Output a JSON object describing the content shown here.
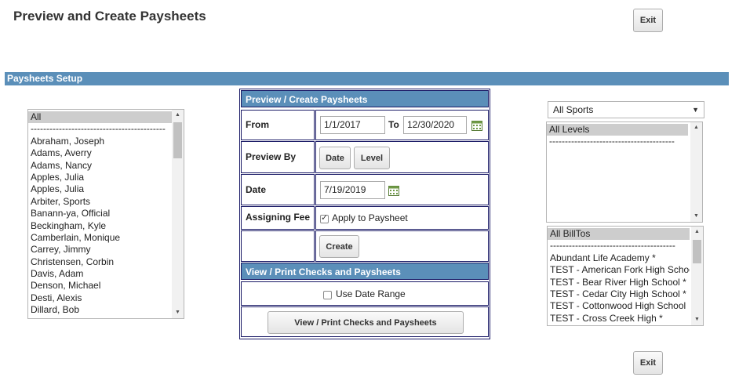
{
  "header": {
    "title": "Preview and Create Paysheets",
    "exit_label": "Exit"
  },
  "setup_bar": {
    "label": "Paysheets Setup"
  },
  "officials_list": {
    "items": [
      "All",
      "-------------------------------------------",
      "Abraham, Joseph",
      "Adams, Averry",
      "Adams, Nancy",
      "Apples, Julia",
      "Apples, Julia",
      "Arbiter, Sports",
      "Banann-ya, Official",
      "Beckingham, Kyle",
      "Camberlain, Monique",
      "Carrey, Jimmy",
      "Christensen, Corbin",
      "Davis, Adam",
      "Denson, Michael",
      "Desti, Alexis",
      "Dillard, Bob"
    ],
    "selected": "All"
  },
  "preview_panel": {
    "header": "Preview / Create Paysheets",
    "from_label": "From",
    "from_value": "1/1/2017",
    "to_label": "To",
    "to_value": "12/30/2020",
    "preview_by_label": "Preview By",
    "date_button": "Date",
    "level_button": "Level",
    "date_label": "Date",
    "date_value": "7/19/2019",
    "assigning_fee_label": "Assigning Fee",
    "apply_label": "Apply to Paysheet",
    "apply_checked": true,
    "create_button": "Create"
  },
  "print_panel": {
    "header": "View / Print Checks and Paysheets",
    "use_date_range_label": "Use Date Range",
    "use_date_range_checked": false,
    "view_print_button": "View / Print Checks and Paysheets"
  },
  "sports_select": {
    "value": "All Sports"
  },
  "levels_list": {
    "items": [
      "All Levels",
      "----------------------------------------"
    ],
    "selected": "All Levels"
  },
  "billtos_list": {
    "items": [
      "All BillTos",
      "----------------------------------------",
      "Abundant Life Academy *",
      "TEST - American Fork High School",
      "TEST - Bear River High School *",
      "TEST - Cedar City High School *",
      "TEST - Cottonwood High School",
      "TEST - Cross Creek High *"
    ],
    "selected": "All BillTos"
  },
  "footer": {
    "exit_label": "Exit"
  },
  "colors": {
    "header_bar": "#5b8fb9",
    "panel_border": "#1a1a66"
  }
}
